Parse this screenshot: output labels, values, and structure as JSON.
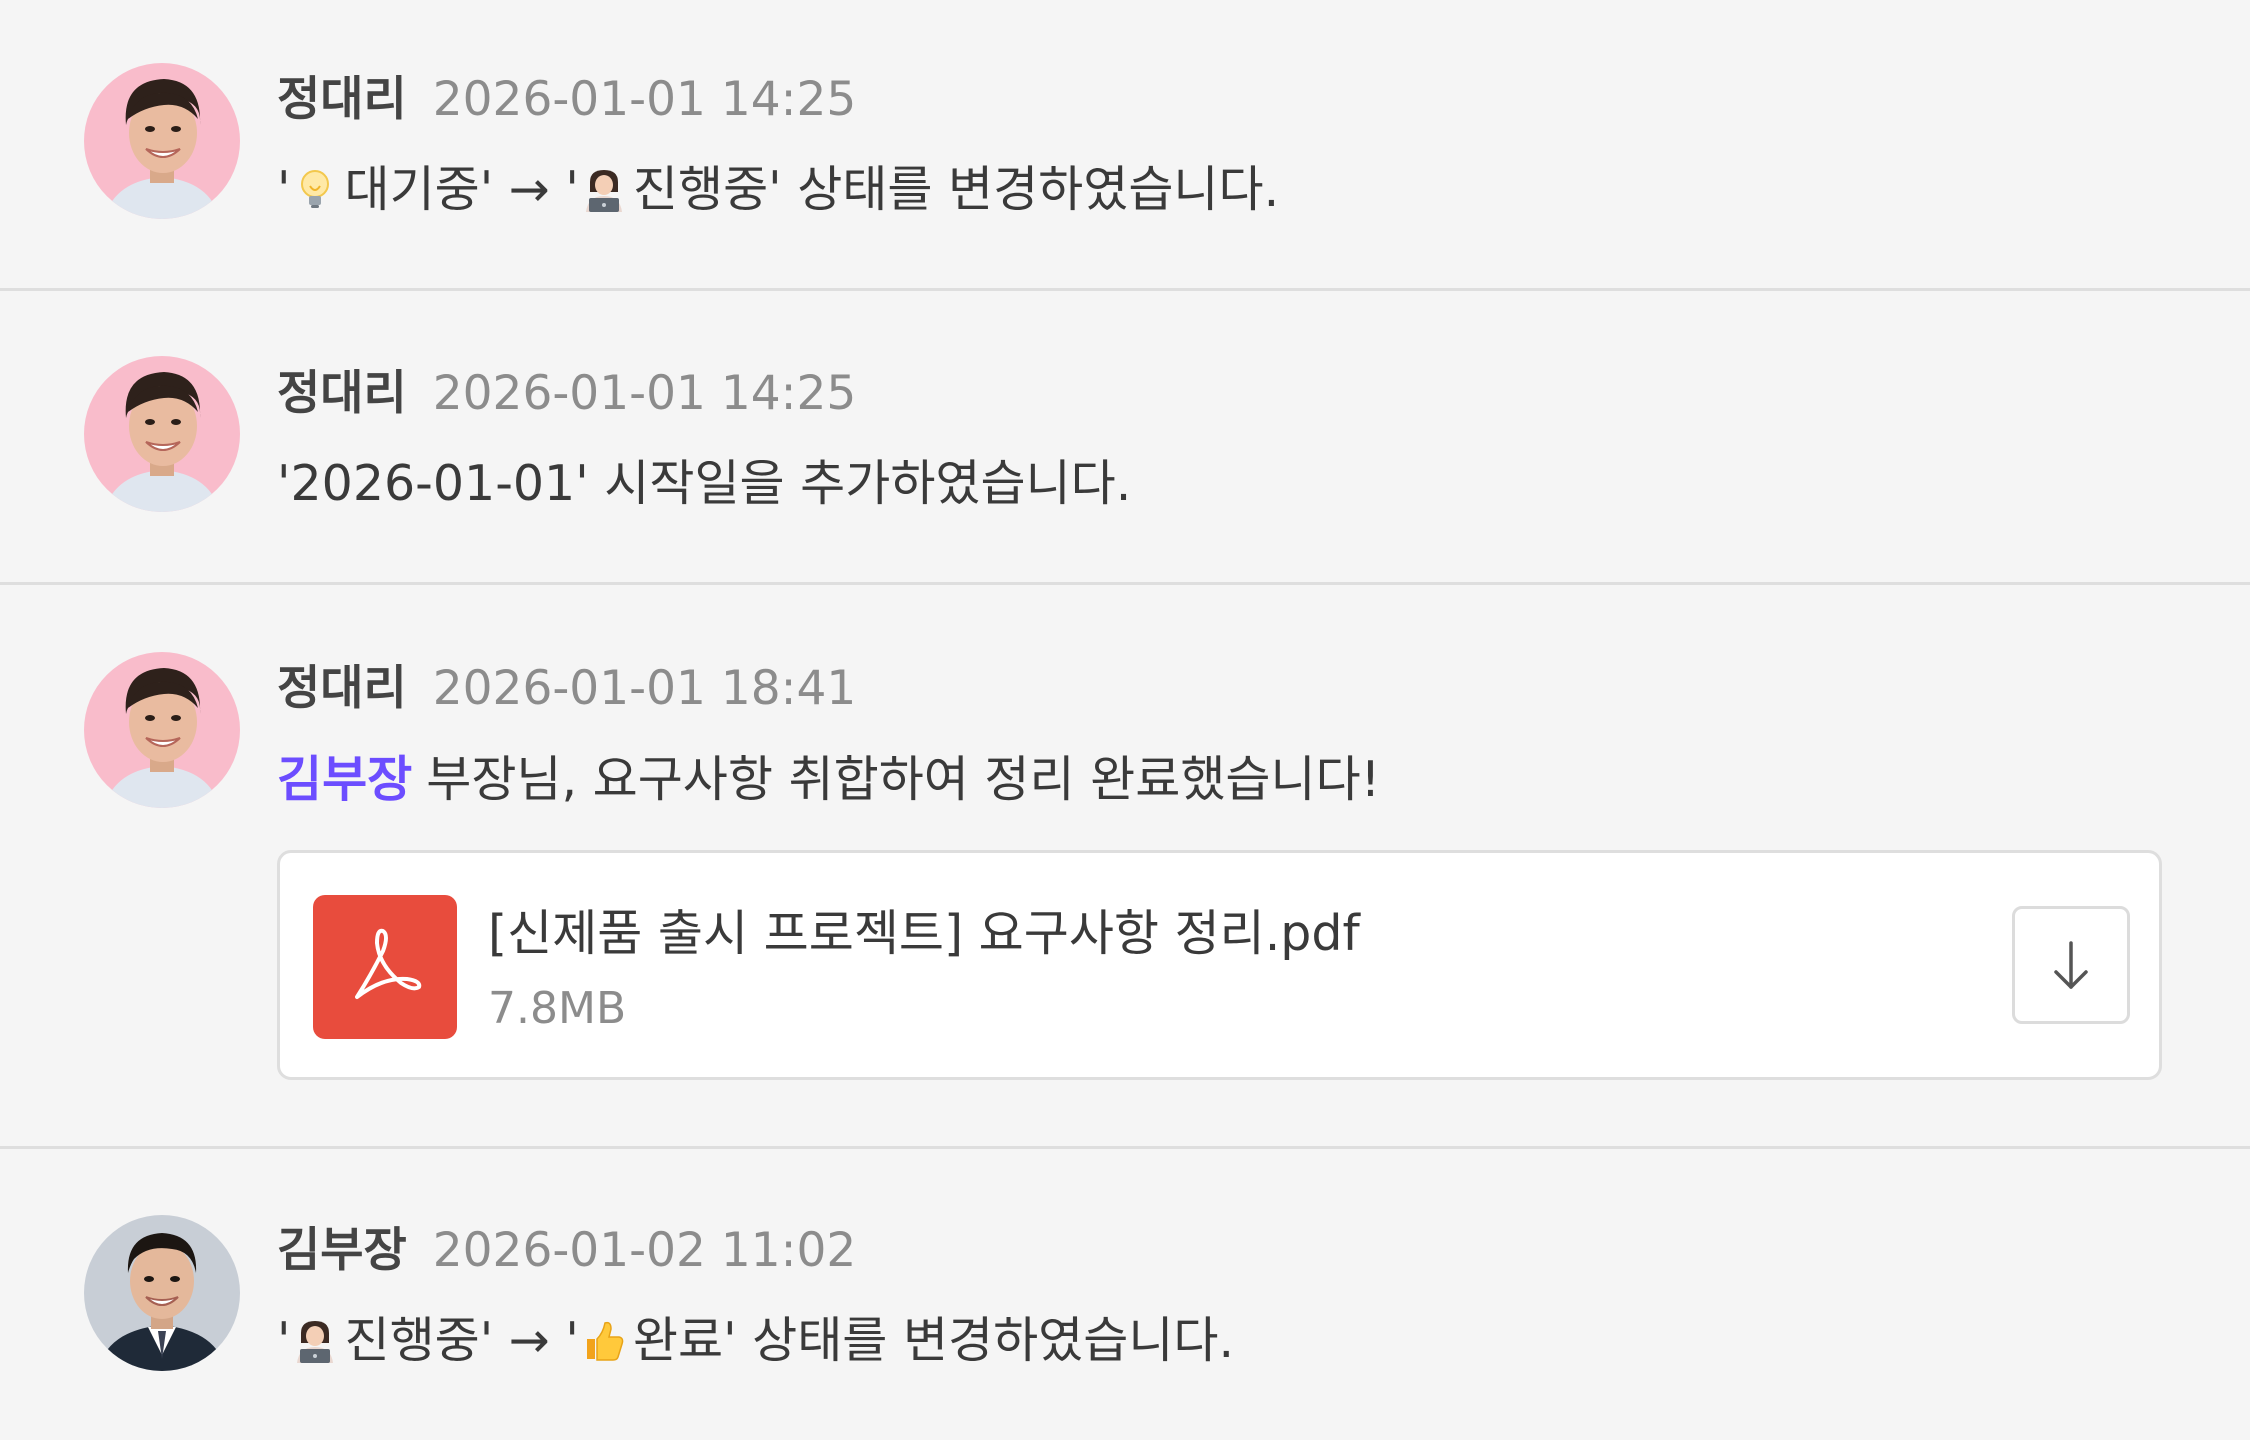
{
  "feed": [
    {
      "author": "정대리",
      "time": "2026-01-01 14:25",
      "text": {
        "q1": "'",
        "from": "대기중'",
        "arrow": "→",
        "q2": "'",
        "to": "진행중'",
        "rest": "상태를 변경하였습니다."
      },
      "icons": [
        "lightbulb-icon",
        "person-laptop-icon"
      ]
    },
    {
      "author": "정대리",
      "time": "2026-01-01 14:25",
      "text": "'2026-01-01' 시작일을 추가하였습니다."
    },
    {
      "author": "정대리",
      "time": "2026-01-01 18:41",
      "mention": "김부장",
      "text": "부장님, 요구사항 취합하여 정리 완료했습니다!",
      "attachment": {
        "name": "[신제품 출시 프로젝트] 요구사항 정리.pdf",
        "size": "7.8MB",
        "icon": "pdf-icon",
        "action_icon": "download-arrow-icon"
      }
    },
    {
      "author": "김부장",
      "time": "2026-01-02 11:02",
      "text": {
        "q1": "'",
        "from": "진행중'",
        "arrow": "→",
        "q2": "'",
        "to": "완료'",
        "rest": "상태를 변경하였습니다."
      },
      "icons": [
        "person-laptop-icon",
        "thumbs-up-icon"
      ]
    }
  ],
  "colors": {
    "background": "#f5f5f5",
    "mention": "#6c4dff",
    "pdf_red": "#e84c3d",
    "divider": "#dedede",
    "muted_text": "#8c8c8c"
  }
}
